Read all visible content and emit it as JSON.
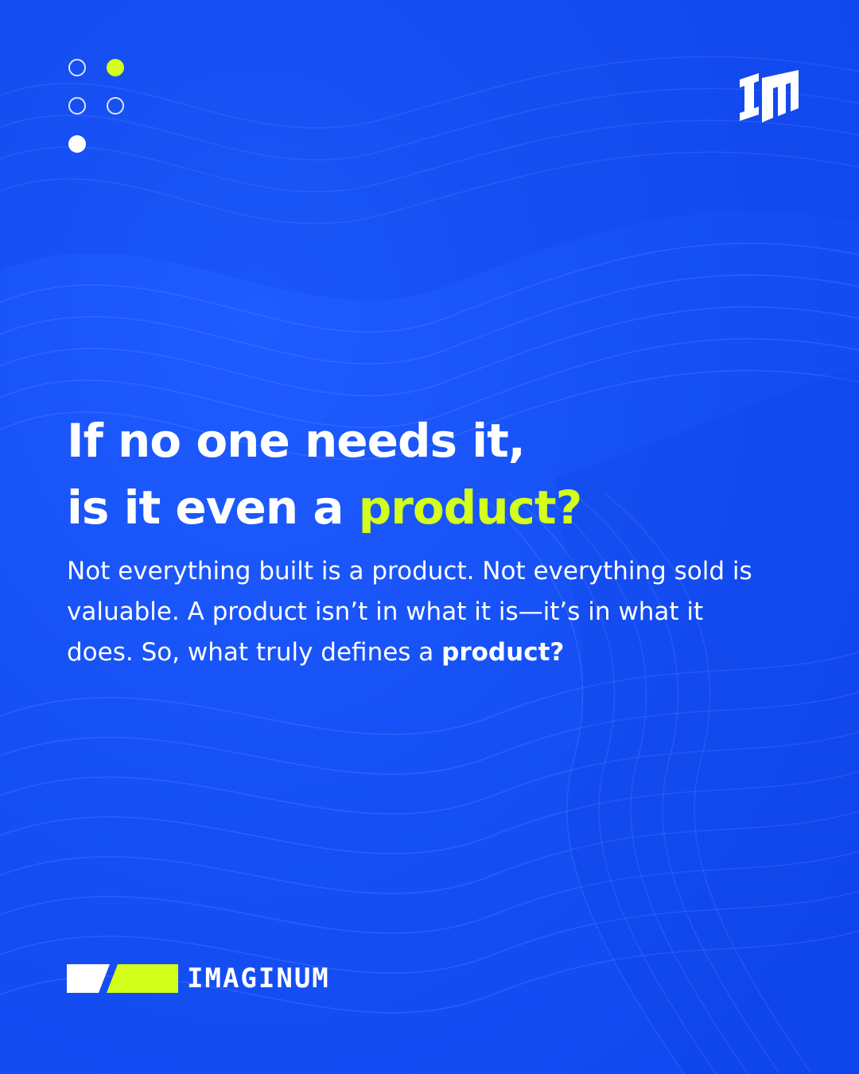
{
  "colors": {
    "background": "#1651f5",
    "accent": "#d4ff1a",
    "text": "#ffffff"
  },
  "pagination": {
    "dots": [
      "outline",
      "lime",
      "outline",
      "outline",
      "white"
    ]
  },
  "logo": {
    "icon": "im-monogram-icon",
    "letters": "IM"
  },
  "headline": {
    "line1": "If no one needs it,",
    "line2_prefix": "is it even a ",
    "line2_accent": "product?"
  },
  "body": {
    "text": "Not everything built is a product. Not everything sold is valuable. A product isn’t in what it is—it’s in what it does. So, what truly defines a ",
    "bold": "product?"
  },
  "brand": {
    "icon": "imaginum-stripes-icon",
    "name": "IMAGINUM"
  }
}
